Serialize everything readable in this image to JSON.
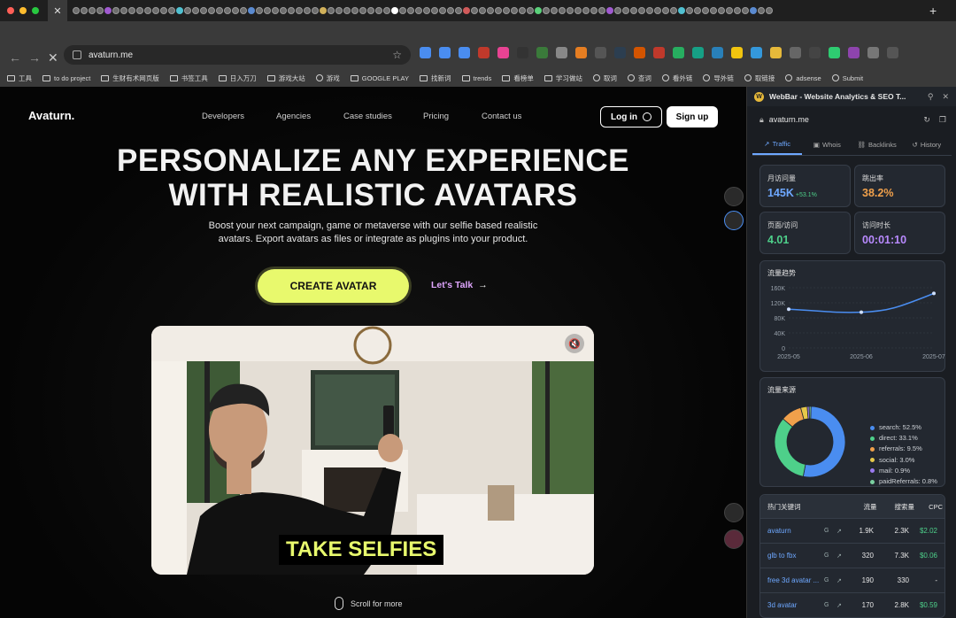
{
  "browser": {
    "url": "avaturn.me",
    "bookmarks": [
      "工具",
      "to do project",
      "生财有术网页版",
      "书签工具",
      "日入万刀",
      "游戏大站",
      "游戏",
      "GOOGLE PLAY",
      "找新词",
      "trends",
      "看榜单",
      "学习做站",
      "取词",
      "查词",
      "看外链",
      "导外链",
      "取链接",
      "adsense",
      "Submit"
    ]
  },
  "site": {
    "logo": "Avaturn.",
    "nav": [
      "Developers",
      "Agencies",
      "Case studies",
      "Pricing",
      "Contact us"
    ],
    "login_label": "Log in",
    "signup_label": "Sign up",
    "headline_line1": "PERSONALIZE ANY EXPERIENCE",
    "headline_line2": "WITH REALISTIC AVATARS",
    "sub_line1": "Boost your next campaign, game or metaverse with our selfie based realistic",
    "sub_line2": "avatars. Export avatars as files or integrate as plugins into your product.",
    "cta_create": "CREATE AVATAR",
    "cta_talk": "Let's Talk",
    "hero_caption": "TAKE SELFIES",
    "scroll_hint": "Scroll for more"
  },
  "webbar": {
    "title": "WebBar - Website Analytics & SEO T...",
    "domain": "avaturn.me",
    "tabs": [
      "Traffic",
      "Whois",
      "Backlinks",
      "History"
    ],
    "stats": [
      {
        "label": "月访问量",
        "value": "145K",
        "delta": "+53.1%",
        "color": "#6ea8ff"
      },
      {
        "label": "跳出率",
        "value": "38.2%",
        "delta": "",
        "color": "#f0a04b"
      },
      {
        "label": "页面/访问",
        "value": "4.01",
        "delta": "",
        "color": "#4ed08a"
      },
      {
        "label": "访问时长",
        "value": "00:01:10",
        "delta": "",
        "color": "#b98aff"
      }
    ],
    "trend_title": "流量趋势",
    "source_title": "流量来源",
    "keywords_title": "热门关键词",
    "kw_columns": [
      "流量",
      "搜索量",
      "CPC"
    ],
    "keywords": [
      {
        "kw": "avaturn",
        "traffic": "1.9K",
        "volume": "2.3K",
        "cpc": "$2.02"
      },
      {
        "kw": "glb to fbx",
        "traffic": "320",
        "volume": "7.3K",
        "cpc": "$0.06"
      },
      {
        "kw": "free 3d avatar ...",
        "traffic": "190",
        "volume": "330",
        "cpc": "-"
      },
      {
        "kw": "3d avatar",
        "traffic": "170",
        "volume": "2.8K",
        "cpc": "$0.59"
      }
    ]
  },
  "chart_data": [
    {
      "type": "line",
      "x": [
        "2025-05",
        "2025-06",
        "2025-07"
      ],
      "y_ticks": [
        "0",
        "40K",
        "80K",
        "120K",
        "160K"
      ],
      "series": [
        {
          "values": [
            103000,
            95000,
            145000
          ]
        }
      ],
      "ylim": [
        0,
        160000
      ],
      "grid": true
    },
    {
      "type": "pie",
      "donut": true,
      "labels": [
        "search: 52.5%",
        "direct: 33.1%",
        "referrals: 9.5%",
        "social: 3.0%",
        "mail: 0.9%",
        "paidReferrals: 0.8%"
      ],
      "values": [
        52.5,
        33.1,
        9.5,
        3.0,
        0.9,
        0.8
      ],
      "colors": [
        "#4a8df0",
        "#4ed08a",
        "#f0a04b",
        "#e6c84a",
        "#9b7af0",
        "#7ad0a0"
      ],
      "legend": "right"
    }
  ]
}
